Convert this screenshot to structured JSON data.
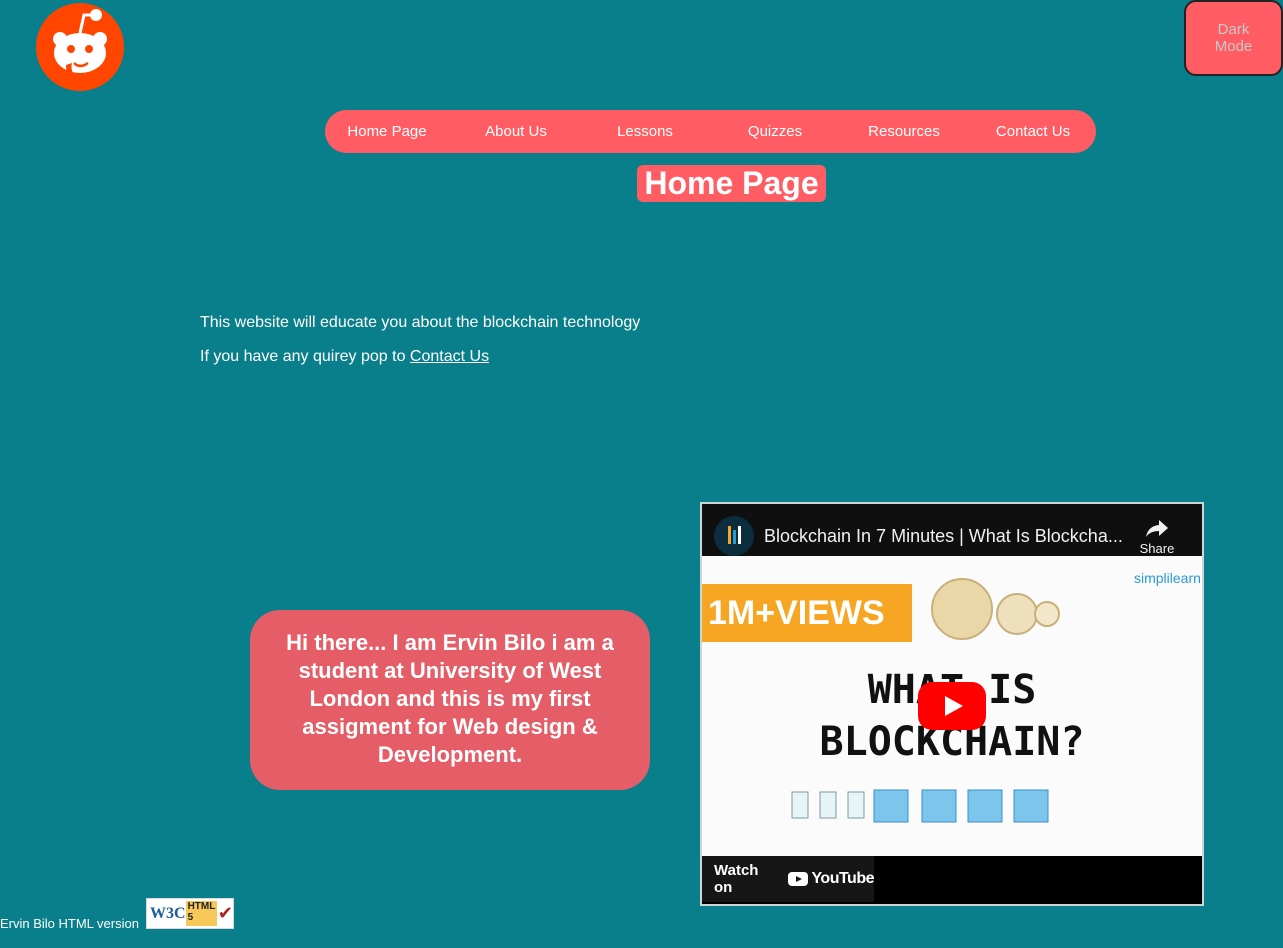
{
  "header": {
    "logo_icon": "reddit-alien-icon",
    "dark_mode_label": "Dark Mode"
  },
  "nav": {
    "items": [
      {
        "label": "Home Page"
      },
      {
        "label": "About Us"
      },
      {
        "label": "Lessons"
      },
      {
        "label": "Quizzes"
      },
      {
        "label": "Resources"
      },
      {
        "label": "Contact Us"
      }
    ]
  },
  "page_title": "Home Page",
  "intro": {
    "line1": "This website will educate you about the blockchain technology",
    "line2_prefix": "If you have any quirey pop to ",
    "line2_link": "Contact Us"
  },
  "bubble_text": "Hi there... I am Ervin Bilo i am a student at University of West London and this is my first assigment for Web design & Development.",
  "video": {
    "title": "Blockchain In 7 Minutes | What Is Blockcha...",
    "share_label": "Share",
    "banner_text": "1M+VIEWS",
    "brand_text": "simplilearn",
    "thumb_heading": "WHAT IS BLOCKCHAIN?",
    "watch_on_label": "Watch on",
    "youtube_label": "YouTube"
  },
  "footer": {
    "text": "Ervin Bilo HTML version",
    "badge_w3c": "W3C",
    "badge_html": "HTML 5"
  },
  "colors": {
    "background": "#087f8a",
    "accent": "#ff5c63",
    "bubble": "#e55d66"
  }
}
